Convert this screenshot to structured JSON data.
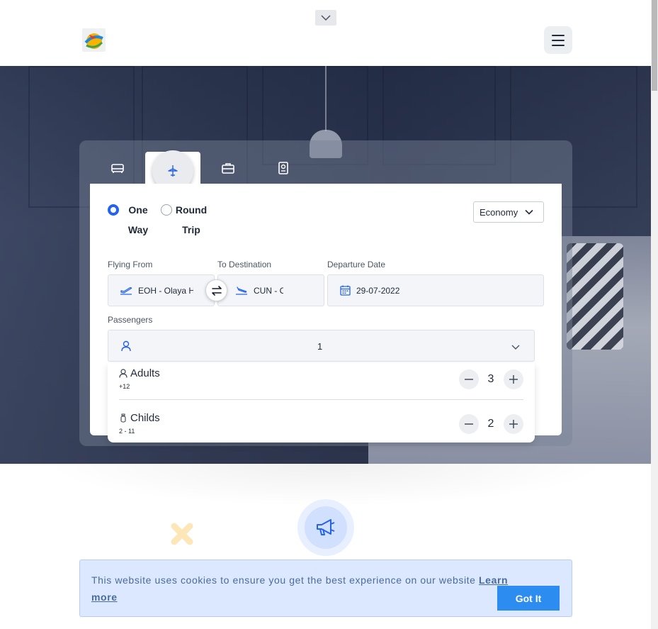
{
  "header": {
    "collapse_icon": "chevron-down-icon",
    "logo_icon": "travel-logo",
    "menu_icon": "hamburger-menu-icon"
  },
  "tabs": [
    {
      "name": "hotels",
      "icon": "bed-icon",
      "active": false
    },
    {
      "name": "flights",
      "icon": "plane-icon",
      "active": true
    },
    {
      "name": "tours",
      "icon": "briefcase-icon",
      "active": false
    },
    {
      "name": "visa",
      "icon": "passport-icon",
      "active": false
    }
  ],
  "trip_type": {
    "one_way": {
      "line1": "One",
      "line2": "Way",
      "checked": true
    },
    "round_trip": {
      "line1": "Round",
      "line2": "Trip",
      "checked": false
    }
  },
  "cabin_class": {
    "selected": "Economy"
  },
  "flying_from": {
    "label": "Flying From",
    "value": "EOH - Olaya H"
  },
  "to_destination": {
    "label": "To Destination",
    "value": "CUN - C"
  },
  "departure_date": {
    "label": "Departure Date",
    "value": "29-07-2022"
  },
  "passengers": {
    "label": "Passengers",
    "total": "1",
    "adults": {
      "label": "Adults",
      "sub": "+12",
      "count": "3"
    },
    "childs": {
      "label": "Childs",
      "sub": "2 - 11",
      "count": "2"
    }
  },
  "cookie_banner": {
    "text": "This website uses cookies to ensure you get the best experience on our website",
    "link": "Learn more",
    "button": "Got It"
  },
  "colors": {
    "accent": "#2563eb",
    "cookie_bg": "#dce8ff",
    "cookie_button": "#2d8cf0"
  }
}
